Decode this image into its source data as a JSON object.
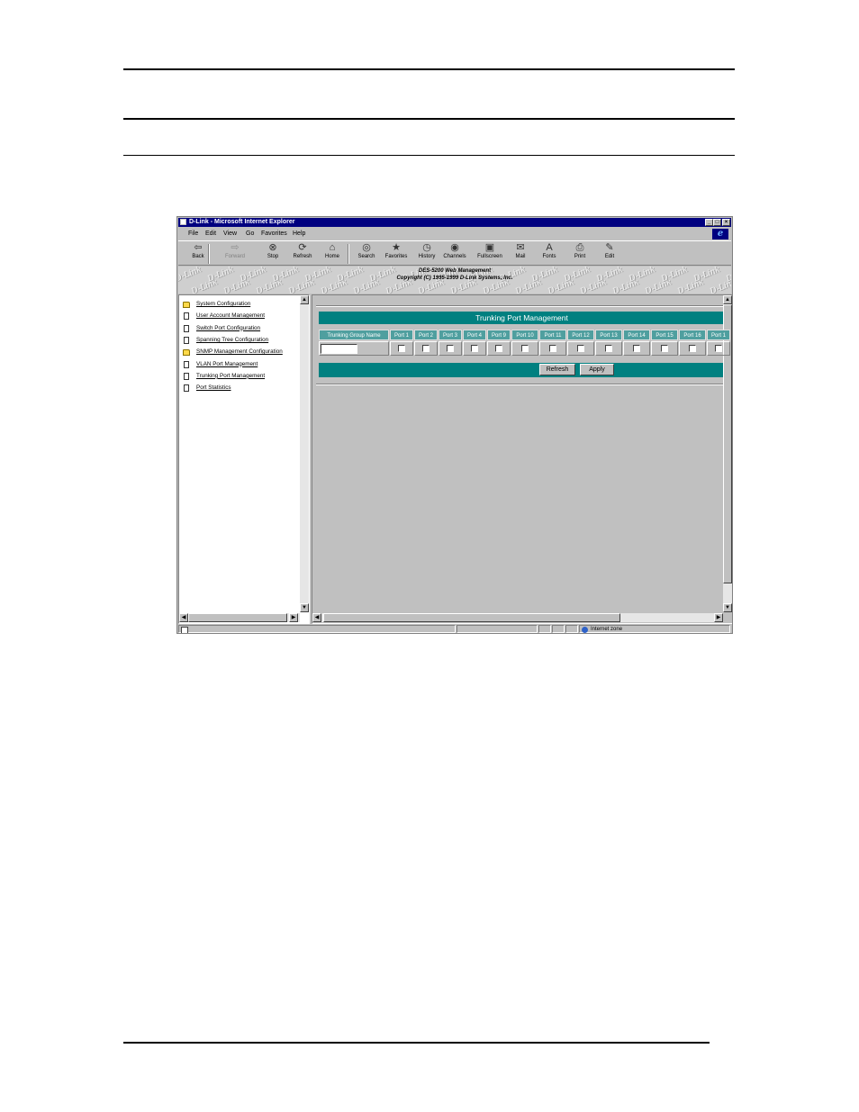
{
  "window": {
    "title": "D-Link - Microsoft Internet Explorer",
    "menus": [
      "File",
      "Edit",
      "View",
      "Go",
      "Favorites",
      "Help"
    ],
    "toolbar": [
      {
        "label": "Back",
        "icon": "back-arrow-icon",
        "glyph": "⇦",
        "enabled": true
      },
      {
        "label": "Forward",
        "icon": "forward-arrow-icon",
        "glyph": "⇨",
        "enabled": false
      },
      {
        "label": "Stop",
        "icon": "stop-icon",
        "glyph": "⊗",
        "enabled": true
      },
      {
        "label": "Refresh",
        "icon": "refresh-icon",
        "glyph": "⟳",
        "enabled": true
      },
      {
        "label": "Home",
        "icon": "home-icon",
        "glyph": "⌂",
        "enabled": true
      },
      {
        "label": "Search",
        "icon": "search-icon",
        "glyph": "◎",
        "enabled": true
      },
      {
        "label": "Favorites",
        "icon": "favorites-icon",
        "glyph": "★",
        "enabled": true
      },
      {
        "label": "History",
        "icon": "history-icon",
        "glyph": "◷",
        "enabled": true
      },
      {
        "label": "Channels",
        "icon": "channels-icon",
        "glyph": "◉",
        "enabled": true
      },
      {
        "label": "Fullscreen",
        "icon": "fullscreen-icon",
        "glyph": "▣",
        "enabled": true
      },
      {
        "label": "Mail",
        "icon": "mail-icon",
        "glyph": "✉",
        "enabled": true
      },
      {
        "label": "Fonts",
        "icon": "fonts-icon",
        "glyph": "A",
        "enabled": true
      },
      {
        "label": "Print",
        "icon": "print-icon",
        "glyph": "⎙",
        "enabled": true
      },
      {
        "label": "Edit",
        "icon": "edit-icon",
        "glyph": "✎",
        "enabled": true
      }
    ],
    "status": "Internet zone"
  },
  "banner": {
    "watermark": "D-Link",
    "line1": "DES-5200 Web Management",
    "line2": "Copyright (C) 1995-1999 D-Link Systems, Inc."
  },
  "nav": [
    {
      "label": "System Configuration",
      "icon": "folder-icon"
    },
    {
      "label": "User Account Management",
      "icon": "page-icon"
    },
    {
      "label": "Switch Port Configuration",
      "icon": "page-icon"
    },
    {
      "label": "Spanning Tree Configuration",
      "icon": "page-icon"
    },
    {
      "label": "SNMP Management Configuration",
      "icon": "folder-icon"
    },
    {
      "label": "VLAN Port Management",
      "icon": "page-icon"
    },
    {
      "label": "Trunking Port Management",
      "icon": "page-icon"
    },
    {
      "label": "Port Statistics",
      "icon": "page-icon"
    }
  ],
  "main": {
    "heading": "Trunking Port Management",
    "name_column": "Trunking Group Name",
    "group_name_value": "",
    "ports": [
      "Port 1",
      "Port 2",
      "Port 3",
      "Port 4",
      "Port 9",
      "Port 10",
      "Port 11",
      "Port 12",
      "Port 13",
      "Port 14",
      "Port 15",
      "Port 16",
      "Port 1"
    ],
    "refresh_label": "Refresh",
    "apply_label": "Apply"
  }
}
